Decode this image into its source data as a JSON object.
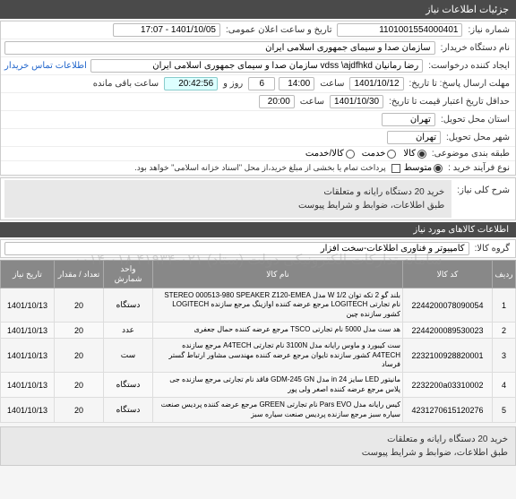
{
  "header": {
    "title": "جزئیات اطلاعات نیاز"
  },
  "info": {
    "need_no_label": "شماره نیاز:",
    "need_no": "1101001554000401",
    "public_datetime_label": "تاریخ و ساعت اعلان عمومی:",
    "public_datetime": "1401/10/05 - 17:07",
    "buyer_name_label": "نام دستگاه خریدار:",
    "buyer_name": "سازمان صدا و سیمای جمهوری اسلامی ایران",
    "requester_label": "ایجاد کننده درخواست:",
    "requester": "رضا رمانیان vdss \\ajdfhkd سازمان صدا و سیمای جمهوری اسلامی ایران",
    "contact_link": "اطلاعات تماس خریدار",
    "deadline_label": "مهلت ارسال پاسخ: تا تاریخ:",
    "deadline_date": "1401/10/12",
    "time_label": "ساعت",
    "deadline_time": "14:00",
    "days_label": "روز و",
    "days": "6",
    "countdown": "20:42:56",
    "remain_label": "ساعت باقی مانده",
    "credit_end_label": "حداقل تاریخ اعتبار قیمت تا تاریخ:",
    "credit_end_date": "1401/10/30",
    "credit_end_time": "20:00",
    "deliver_province_label": "استان محل تحویل:",
    "deliver_province": "تهران",
    "deliver_city_label": "شهر محل تحویل:",
    "deliver_city": "تهران",
    "category_label": "طبقه بندی موضوعی:",
    "cat_kala": "کالا",
    "cat_service": "خدمت",
    "cat_kala_service": "کالا/خدمت",
    "purchase_type_label": "نوع فرآیند خرید :",
    "purchase_type_metavast": "متوسط",
    "purchase_note": "پرداخت تمام یا بخشی از مبلغ خرید،از محل \"اسناد خزانه اسلامی\" خواهد بود.",
    "desc_label": "شرح کلی نیاز:",
    "desc_line1": "خرید 20 دستگاه رایانه و متعلقات",
    "desc_line2": "طبق اطلاعات، ضوابط و شرایط پیوست"
  },
  "items_header": "اطلاعات کالاهای مورد نیاز",
  "group_label": "گروه کالا:",
  "group_value": "کامپیوتر و فناوری اطلاعات-سخت افزار",
  "table": {
    "headers": [
      "ردیف",
      "کد کالا",
      "نام کالا",
      "واحد شمارش",
      "تعداد / مقدار",
      "تاریخ نیاز"
    ],
    "rows": [
      {
        "n": "1",
        "code": "2244200078090054",
        "name": "بلند گو 2 تکه توان W 1/2 مدل STEREO 000513-980 SPEAKER Z120-EMEA نام تجارتی LOGITECH مرجع عرضه کننده اوازینگ مرجع سازنده LOGITECH کشور سازنده چین",
        "unit": "دستگاه",
        "qty": "20",
        "date": "1401/10/13"
      },
      {
        "n": "2",
        "code": "2244200089530023",
        "name": "هد ست مدل 5000 نام تجارتی TSCO مرجع عرضه کننده حمال جعفری",
        "unit": "عدد",
        "qty": "20",
        "date": "1401/10/13"
      },
      {
        "n": "3",
        "code": "2232100928820001",
        "name": "ست کیبورد و ماوس رایانه مدل 3100N نام تجارتی A4TECH مرجع سازنده A4TECH کشور سازنده تایوان مرجع عرضه کننده مهندسی مشاور ارتباط گستر فرساد",
        "unit": "ست",
        "qty": "20",
        "date": "1401/10/13"
      },
      {
        "n": "4",
        "code": "2232200a03310002",
        "name": "مانیتور LED سایز 24 in مدل GDM-245 GN فاقد نام تجارتی مرجع سازنده جی پلاس مرجع عرضه کننده اصغر ولی پور",
        "unit": "دستگاه",
        "qty": "20",
        "date": "1401/10/13"
      },
      {
        "n": "5",
        "code": "4231270615120276",
        "name": "کیس رایانه مدل Pars EVO نام تجارتی GREEN مرجع عرضه کننده پردیس صنعت سیاره سبز مرجع سازنده پردیس صنعت سیاره سبز",
        "unit": "دستگاه",
        "qty": "20",
        "date": "1401/10/13"
      }
    ]
  },
  "footer": {
    "line1": "خرید 20 دستگاه رایانه و متعلقات",
    "line2": "طبق اطلاعات، ضوابط و شرایط پیوست"
  },
  "watermark": "سامانه تدارکات الکترونیکی دولت (ستاد) ۰۲۱-۴۱۹۳۴ ۰۱۸-۰۰۱۴"
}
